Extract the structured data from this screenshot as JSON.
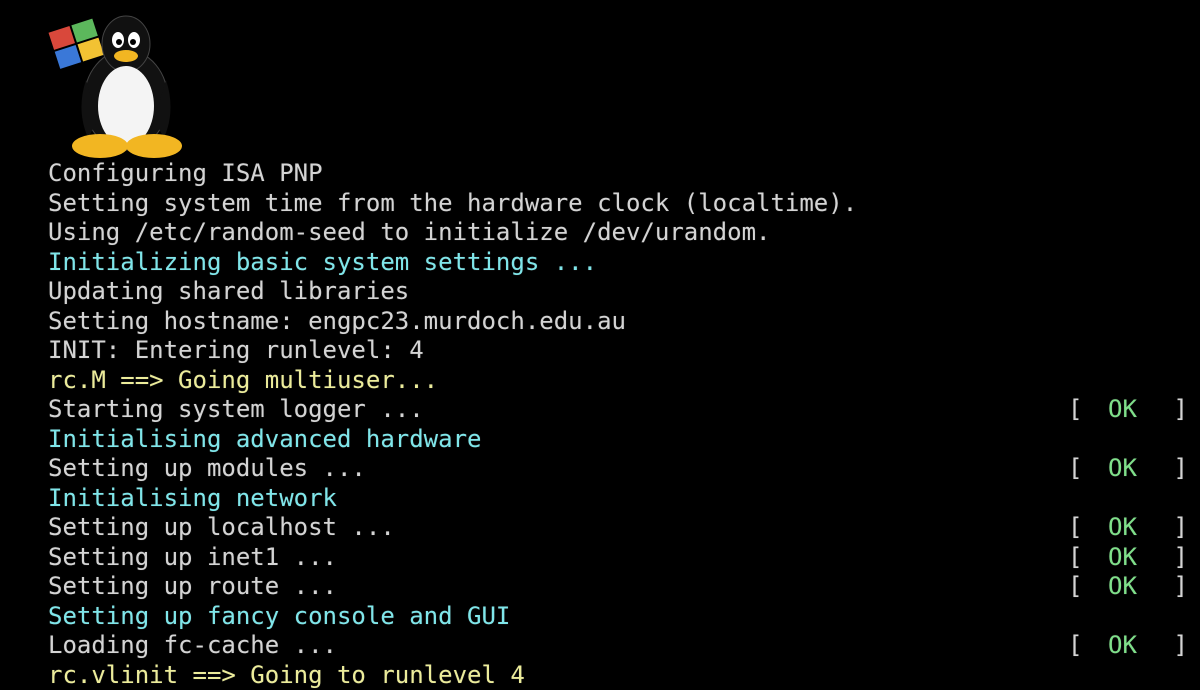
{
  "logo": {
    "icon": "tux-penguin-windows-flag-icon"
  },
  "colors": {
    "background": "#000000",
    "text": "#d4d4d4",
    "heading": "#7fe6ea",
    "highlight": "#ecec9a",
    "ok": "#7fe08a"
  },
  "console": {
    "lines": [
      {
        "text": "Configuring ISA PNP",
        "style": "normal"
      },
      {
        "text": "Setting system time from the hardware clock (localtime).",
        "style": "normal"
      },
      {
        "text": "Using /etc/random-seed to initialize /dev/urandom.",
        "style": "normal"
      },
      {
        "text": "Initializing basic system settings ...",
        "style": "cyan"
      },
      {
        "text": "Updating shared libraries",
        "style": "normal"
      },
      {
        "text": "Setting hostname: engpc23.murdoch.edu.au",
        "style": "normal"
      },
      {
        "text": "INIT: Entering runlevel: 4",
        "style": "normal"
      },
      {
        "text": "rc.M ==> Going multiuser...",
        "style": "yellow"
      },
      {
        "text": "Starting system logger ...",
        "style": "normal",
        "status": "OK"
      },
      {
        "text": "Initialising advanced hardware",
        "style": "cyan"
      },
      {
        "text": "Setting up modules ...",
        "style": "normal",
        "status": "OK"
      },
      {
        "text": "Initialising network",
        "style": "cyan"
      },
      {
        "text": "Setting up localhost ...",
        "style": "normal",
        "status": "OK"
      },
      {
        "text": "Setting up inet1 ...",
        "style": "normal",
        "status": "OK"
      },
      {
        "text": "Setting up route ...",
        "style": "normal",
        "status": "OK"
      },
      {
        "text": "Setting up fancy console and GUI",
        "style": "cyan"
      },
      {
        "text": "Loading fc-cache ...",
        "style": "normal",
        "status": "OK"
      },
      {
        "text": "rc.vlinit ==> Going to runlevel 4",
        "style": "yellow"
      }
    ],
    "bracket_open": "[",
    "bracket_close": "]"
  }
}
